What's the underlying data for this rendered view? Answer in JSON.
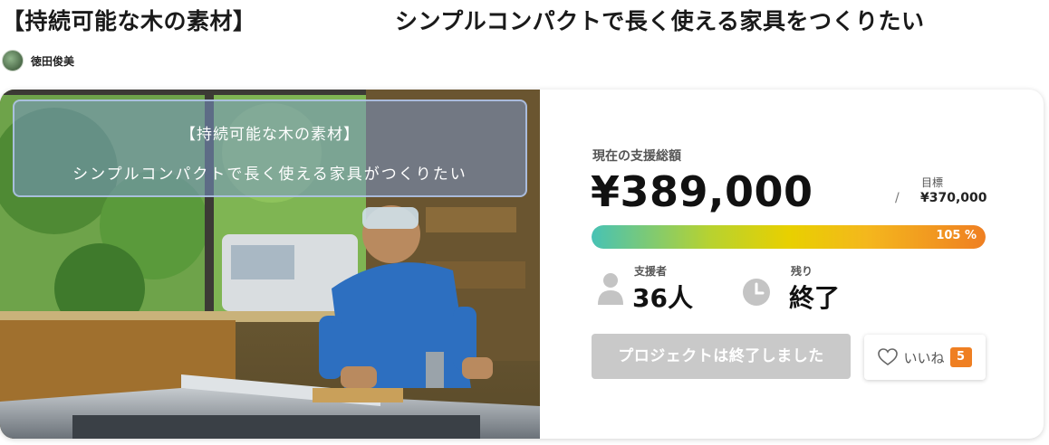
{
  "project": {
    "title": "【持続可能な木の素材】",
    "subtitle": "シンプルコンパクトで長く使える家具をつくりたい"
  },
  "owner": {
    "name": "徳田俊美"
  },
  "hero": {
    "overlay_line1": "【持続可能な木の素材】",
    "overlay_line2": "シンプルコンパクトで長く使える家具がつくりたい"
  },
  "funding": {
    "total_label": "現在の支援総額",
    "total_amount": "¥389,000",
    "slash": "/",
    "goal_label": "目標",
    "goal_amount": "¥370,000",
    "progress_percent": 105,
    "progress_label": "105 %",
    "supporters_label": "支援者",
    "supporters_value": "36人",
    "remaining_label": "残り",
    "remaining_value": "終了"
  },
  "actions": {
    "ended_button_label": "プロジェクトは終了しました",
    "like_label": "いいね",
    "like_count": "5"
  },
  "colors": {
    "accent_orange": "#ef7f22",
    "disabled_gray": "#c9c9c9",
    "progress_start": "#47c2b5",
    "progress_end": "#ef7f22"
  },
  "icons": {
    "supporters": "person-icon",
    "remaining": "clock-icon",
    "like": "heart-icon"
  }
}
